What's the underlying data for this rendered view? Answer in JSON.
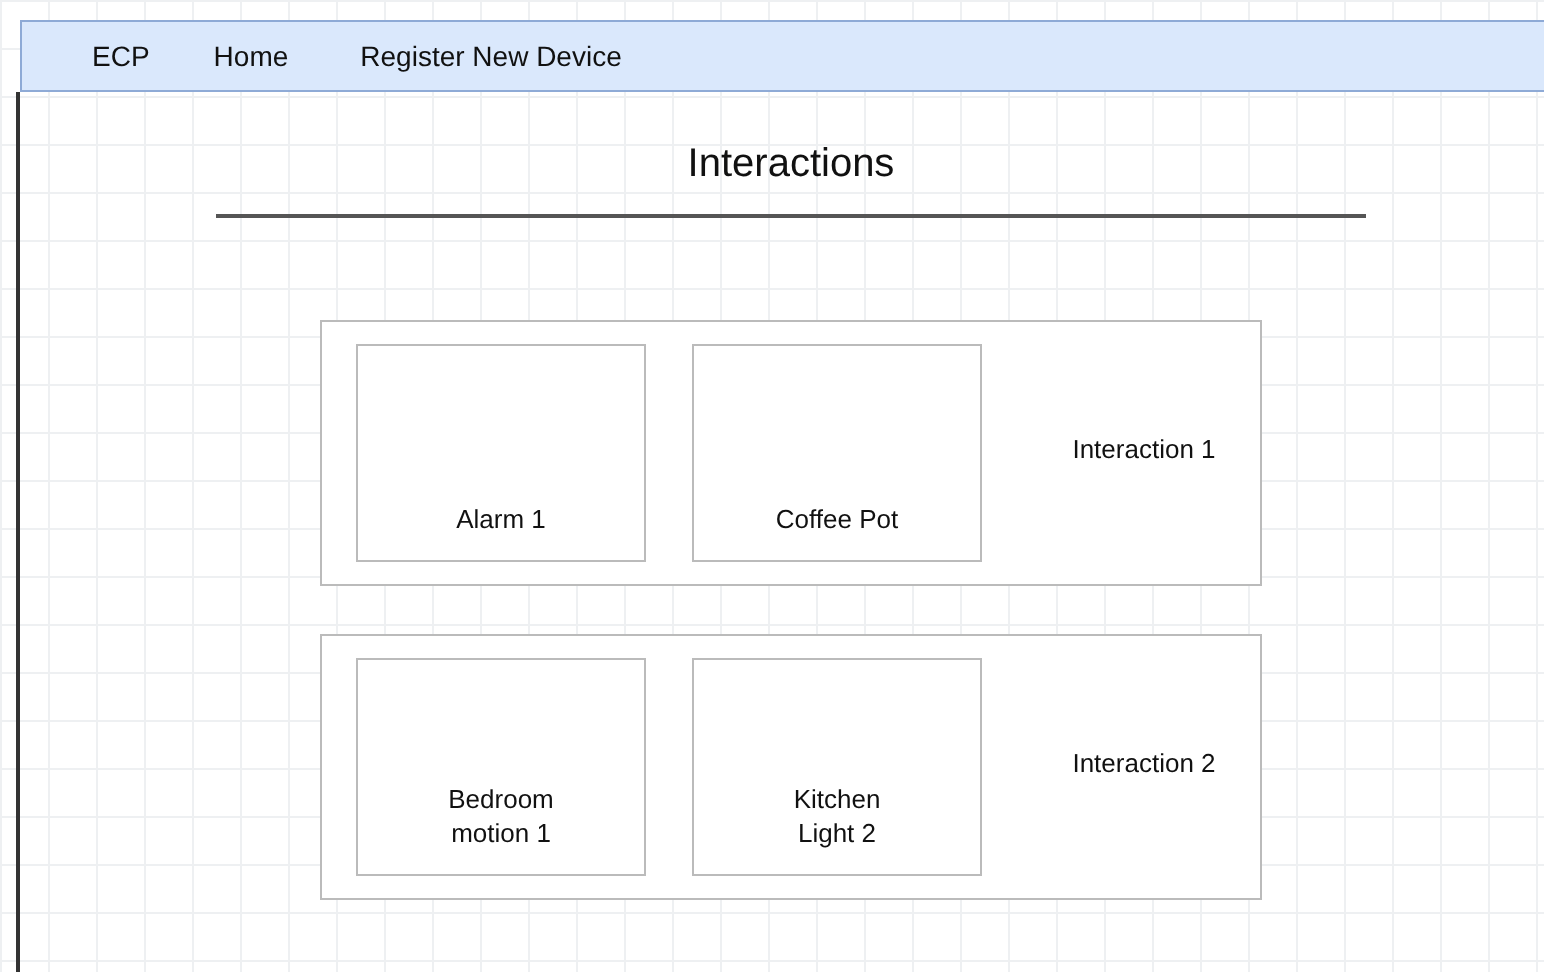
{
  "nav": {
    "items": [
      "ECP",
      "Home",
      "Register New Device"
    ]
  },
  "title": "Interactions",
  "interactions": [
    {
      "label": "Interaction 1",
      "devices": [
        "Alarm 1",
        "Coffee Pot"
      ]
    },
    {
      "label": "Interaction 2",
      "devices": [
        "Bedroom\nmotion 1",
        "Kitchen\nLight 2"
      ]
    }
  ]
}
